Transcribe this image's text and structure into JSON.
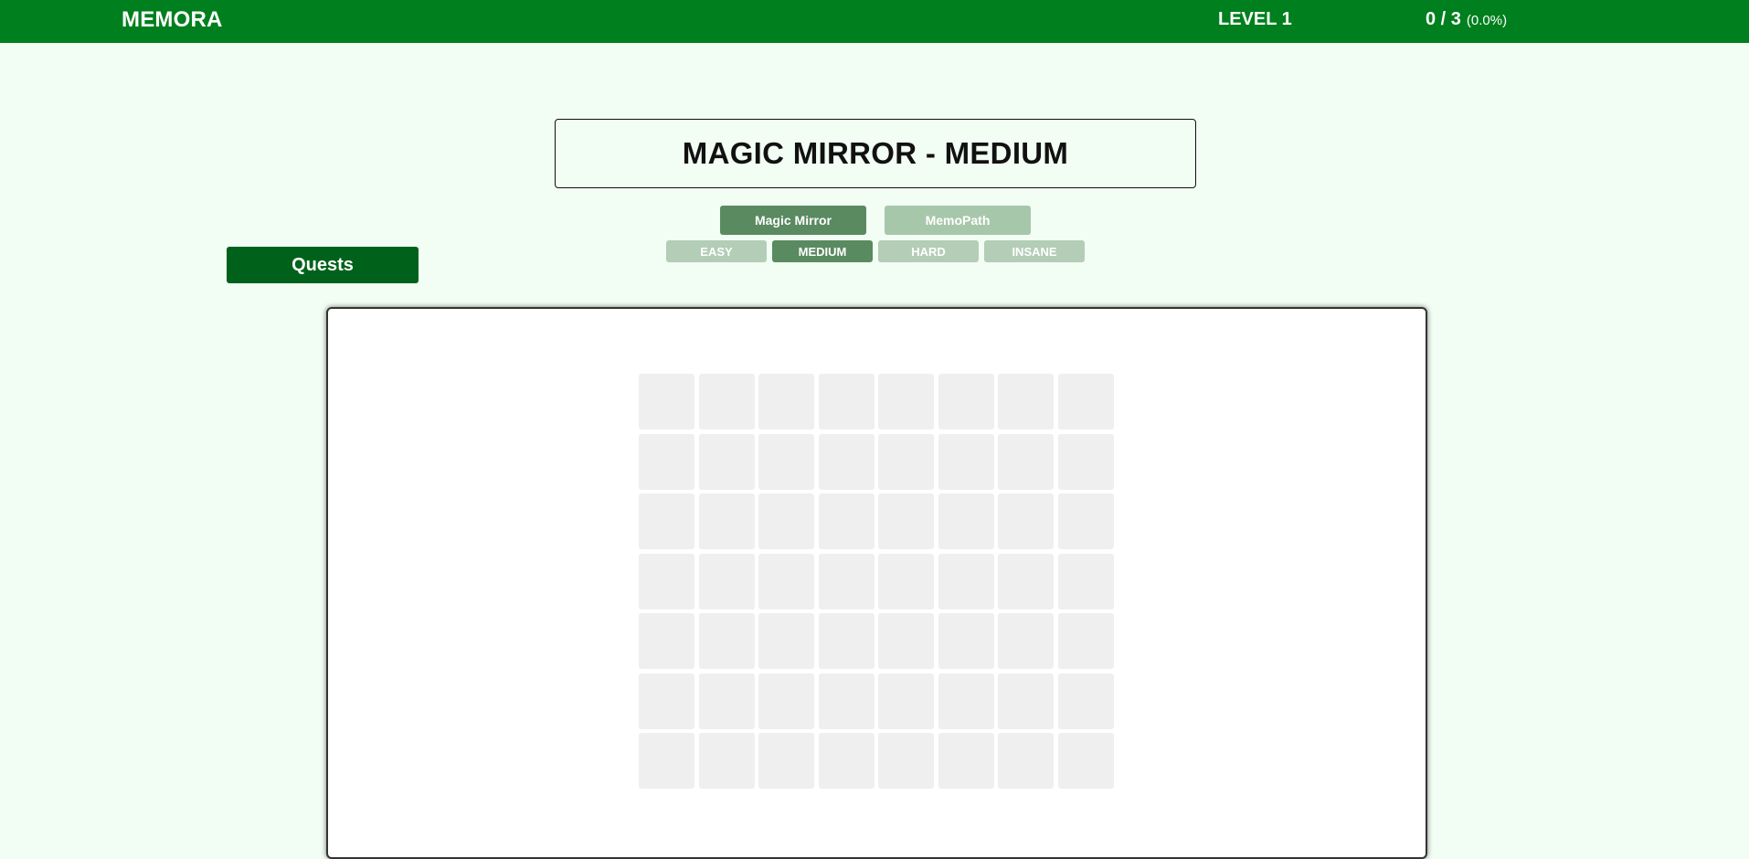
{
  "header": {
    "brand": "MEMORA",
    "level": "LEVEL 1",
    "score": "0 / 3",
    "percent": "(0.0%)"
  },
  "title": "MAGIC MIRROR - MEDIUM",
  "modes": [
    {
      "label": "Magic Mirror",
      "active": true
    },
    {
      "label": "MemoPath",
      "active": false
    }
  ],
  "difficulties": [
    {
      "label": "EASY",
      "active": false
    },
    {
      "label": "MEDIUM",
      "active": true
    },
    {
      "label": "HARD",
      "active": false
    },
    {
      "label": "INSANE",
      "active": false
    }
  ],
  "quests_label": "Quests",
  "board": {
    "rows": 7,
    "cols": 8
  },
  "colors": {
    "header_bg": "#007f1e",
    "page_bg": "#f2fdf4",
    "active_btn": "#5a8a60",
    "inactive_btn": "#a7c7ab",
    "quests_bg": "#00621a",
    "cell": "#efefef"
  }
}
